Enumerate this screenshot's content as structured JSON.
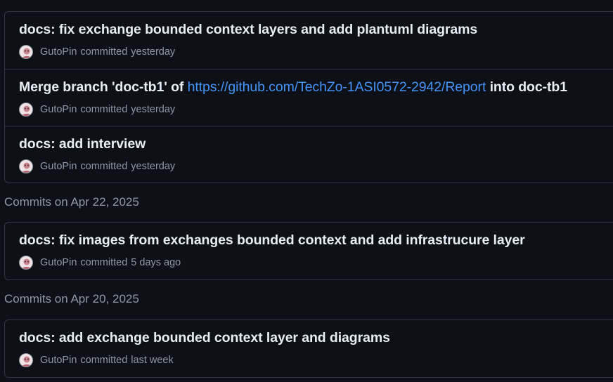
{
  "groups": [
    {
      "commits": [
        {
          "title": "docs: fix exchange bounded context layers and add plantuml diagrams",
          "author": "GutoPin",
          "verb": "committed",
          "time": "yesterday"
        },
        {
          "title_pre": "Merge branch 'doc-tb1' of ",
          "title_link": "https://github.com/TechZo-1ASI0572-2942/Report",
          "title_post": " into doc-tb1",
          "author": "GutoPin",
          "verb": "committed",
          "time": "yesterday"
        },
        {
          "title": "docs: add interview",
          "author": "GutoPin",
          "verb": "committed",
          "time": "yesterday"
        }
      ]
    },
    {
      "heading": "Commits on Apr 22, 2025",
      "commits": [
        {
          "title": "docs: fix images from exchanges bounded context and add infrastrucure layer",
          "author": "GutoPin",
          "verb": "committed",
          "time": "5 days ago"
        }
      ]
    },
    {
      "heading": "Commits on Apr 20, 2025",
      "commits": [
        {
          "title": "docs: add exchange bounded context layer and diagrams",
          "author": "GutoPin",
          "verb": "committed",
          "time": "last week"
        }
      ]
    }
  ],
  "colors": {
    "background": "#0d1117",
    "border": "#30363d",
    "link": "#4493f8",
    "muted": "#9198a1"
  }
}
